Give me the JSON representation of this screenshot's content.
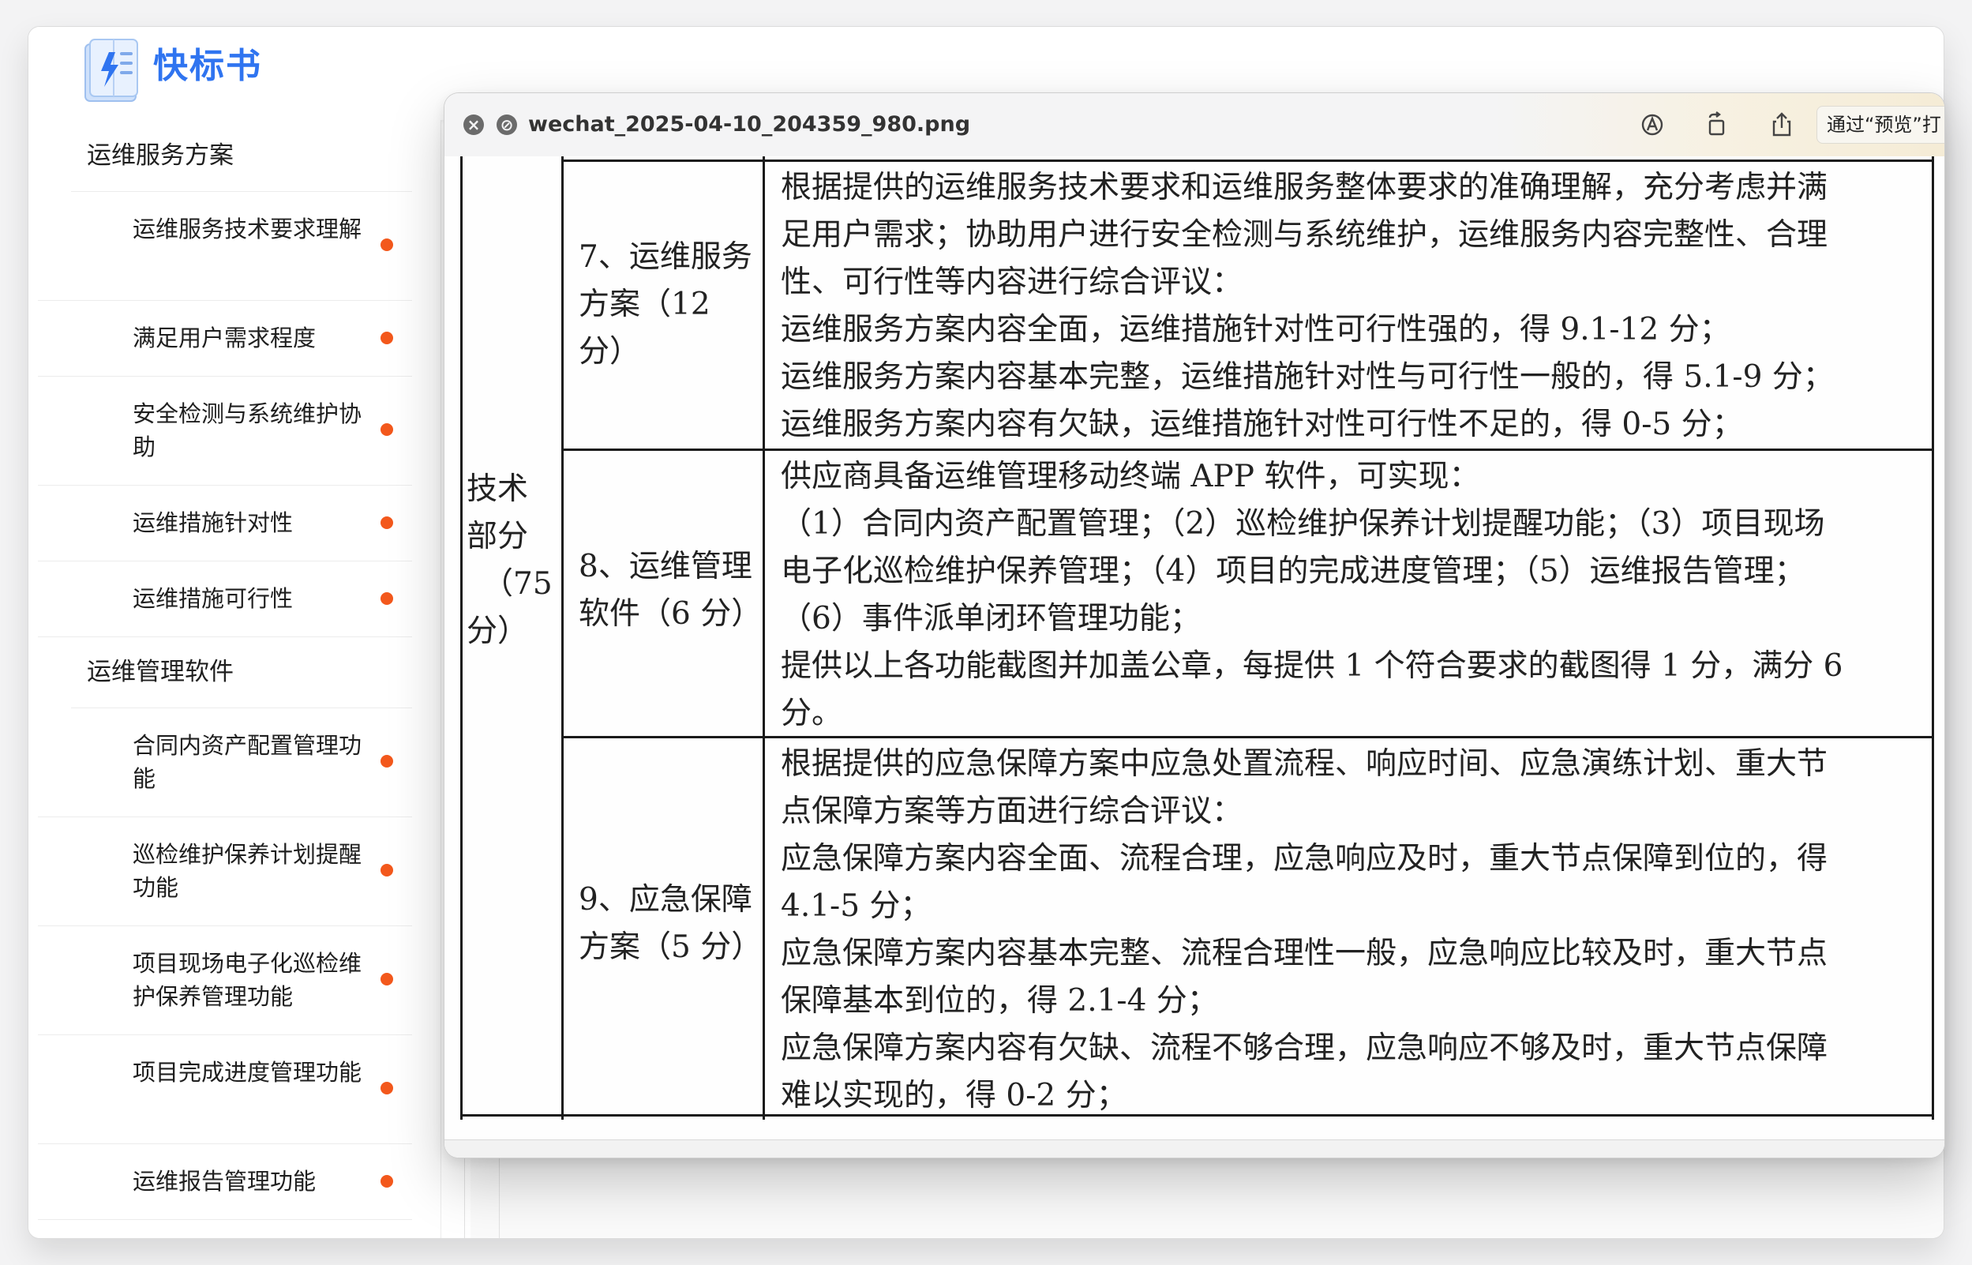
{
  "app": {
    "name": "快标书"
  },
  "sidebar": {
    "groups": [
      {
        "title": "运维服务方案",
        "items": [
          "运维服务技术要求理解",
          "满足用户需求程度",
          "安全检测与系统维护协助",
          "运维措施针对性",
          "运维措施可行性"
        ]
      },
      {
        "title": "运维管理软件",
        "items": [
          "合同内资产配置管理功能",
          "巡检维护保养计划提醒功能",
          "项目现场电子化巡检维护保养管理功能",
          "项目完成进度管理功能",
          "运维报告管理功能"
        ]
      }
    ],
    "dot_color": "#f3581c"
  },
  "preview": {
    "filename": "wechat_2025-04-10_204359_980.png",
    "open_button": "通过“预览”打",
    "toolbar_icons": [
      "markup-icon",
      "rotate-icon",
      "share-icon"
    ]
  },
  "document": {
    "category_lines": [
      "技术",
      "部分",
      "（75",
      "分）"
    ],
    "rows": [
      {
        "label_lines": [
          "7、运维服务",
          "方案（12",
          "分）"
        ],
        "content_lines": [
          "根据提供的运维服务技术要求和运维服务整体要求的准确理解，充分考虑并满",
          "足用户需求；协助用户进行安全检测与系统维护，运维服务内容完整性、合理",
          "性、可行性等内容进行综合评议：",
          "运维服务方案内容全面，运维措施针对性可行性强的，得 9.1-12 分；",
          "运维服务方案内容基本完整，运维措施针对性与可行性一般的，得 5.1-9 分；",
          "运维服务方案内容有欠缺，运维措施针对性可行性不足的，得 0-5 分；"
        ]
      },
      {
        "label_lines": [
          "8、运维管理",
          "软件（6 分）"
        ],
        "content_lines": [
          "供应商具备运维管理移动终端 APP 软件，可实现：",
          "（1）合同内资产配置管理；（2）巡检维护保养计划提醒功能；（3）项目现场",
          "电子化巡检维护保养管理；（4）项目的完成进度管理；（5）运维报告管理；",
          "（6）事件派单闭环管理功能；",
          "提供以上各功能截图并加盖公章，每提供 1 个符合要求的截图得 1 分，满分 6",
          "分。"
        ]
      },
      {
        "label_lines": [
          "9、应急保障",
          "方案（5 分）"
        ],
        "content_lines": [
          "根据提供的应急保障方案中应急处置流程、响应时间、应急演练计划、重大节",
          "点保障方案等方面进行综合评议：",
          "应急保障方案内容全面、流程合理，应急响应及时，重大节点保障到位的，得",
          "4.1-5 分；",
          "应急保障方案内容基本完整、流程合理性一般，应急响应比较及时，重大节点",
          "保障基本到位的，得 2.1-4 分；",
          "应急保障方案内容有欠缺、流程不够合理，应急响应不够及时，重大节点保障",
          "难以实现的，得 0-2 分；"
        ]
      }
    ]
  }
}
